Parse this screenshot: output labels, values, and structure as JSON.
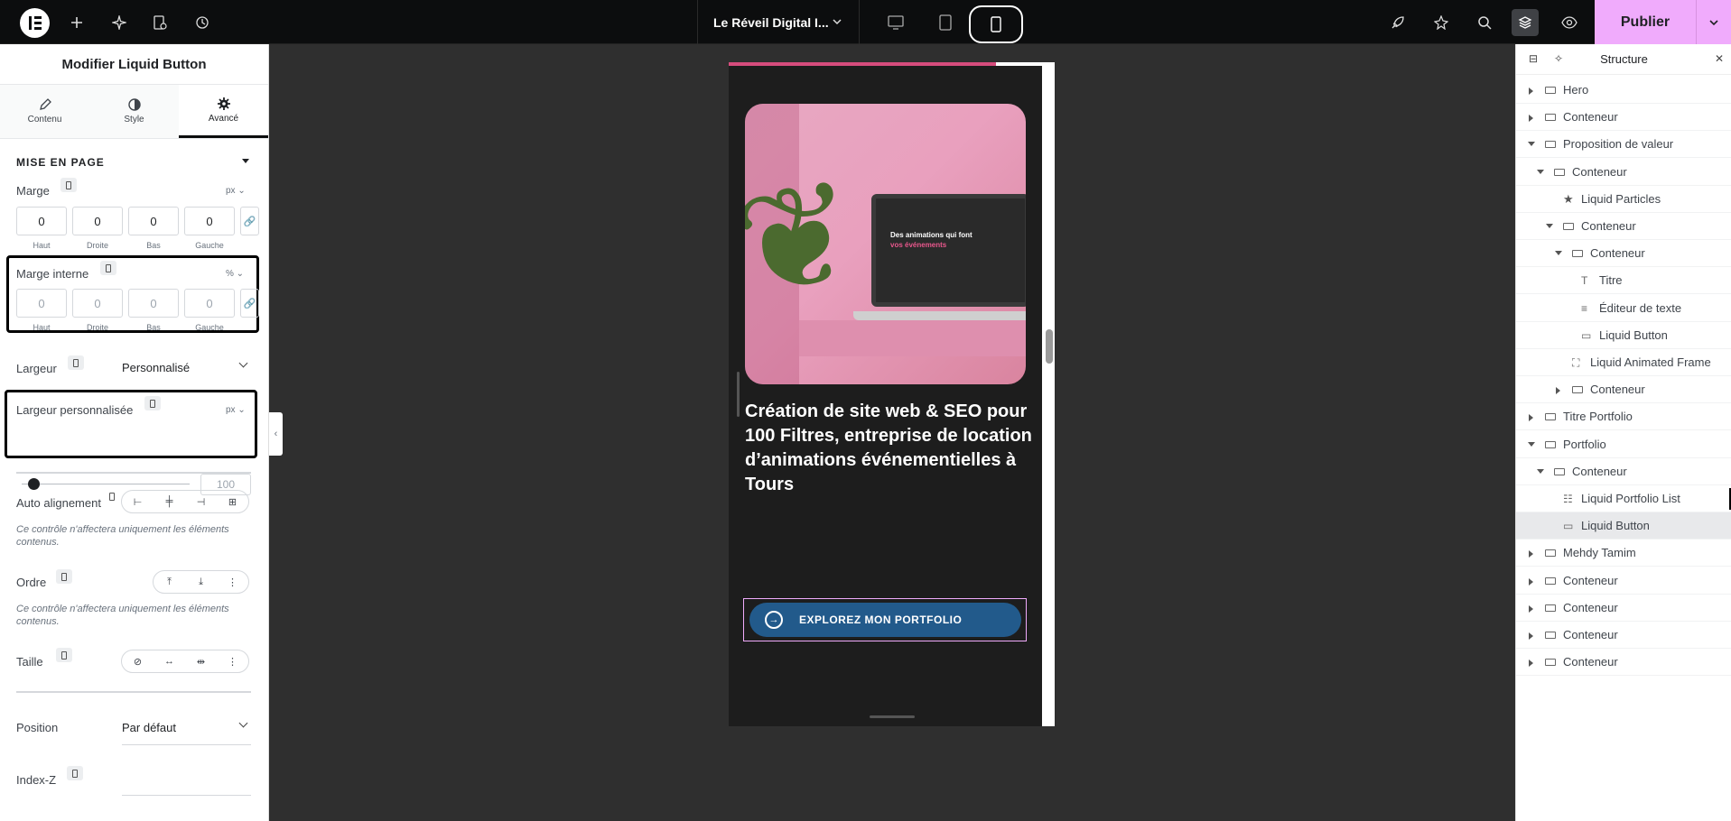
{
  "topbar": {
    "site_name": "Le Réveil Digital I...",
    "publish_label": "Publier",
    "left_icons": [
      "plus-icon",
      "sparkle-icon",
      "page-settings-icon",
      "history-icon"
    ],
    "right_icons": [
      "rocket-icon",
      "launch-icon",
      "search-icon",
      "layers-icon",
      "eye-icon"
    ],
    "devices": [
      "desktop",
      "tablet",
      "mobile"
    ],
    "active_device": "mobile",
    "accent": "#f0abfc"
  },
  "left_panel": {
    "title": "Modifier Liquid Button",
    "tabs": [
      {
        "label": "Contenu",
        "icon": "pencil-icon"
      },
      {
        "label": "Style",
        "icon": "contrast-icon"
      },
      {
        "label": "Avancé",
        "icon": "gear-icon"
      }
    ],
    "active_tab": "Avancé",
    "section": "MISE EN PAGE",
    "marge": {
      "label": "Marge",
      "unit": "px",
      "values": [
        "0",
        "0",
        "0",
        "0"
      ],
      "captions": [
        "Haut",
        "Droite",
        "Bas",
        "Gauche"
      ]
    },
    "marge_interne": {
      "label": "Marge interne",
      "unit": "%",
      "placeholders": [
        "0",
        "0",
        "0",
        "0"
      ],
      "captions": [
        "Haut",
        "Droite",
        "Bas",
        "Gauche"
      ]
    },
    "largeur": {
      "label": "Largeur",
      "value": "Personnalisé"
    },
    "largeur_perso": {
      "label": "Largeur personnalisée",
      "unit": "px",
      "value": "100",
      "slider_fraction": 0.05
    },
    "auto_alignement": {
      "label": "Auto alignement",
      "note": "Ce contrôle n'affectera uniquement les éléments contenus."
    },
    "ordre": {
      "label": "Ordre",
      "note": "Ce contrôle n'affectera uniquement les éléments contenus."
    },
    "taille": {
      "label": "Taille"
    },
    "position": {
      "label": "Position",
      "value": "Par défaut"
    },
    "index_z": {
      "label": "Index-Z"
    }
  },
  "preview": {
    "heading": "Création de site web & SEO pour 100 Filtres, entreprise de location d’animations événementielles à Tours",
    "button_label": "EXPLOREZ MON PORTFOLIO",
    "laptop_text_1": "Des animations qui font",
    "laptop_text_2": "vos événements",
    "colors": {
      "button": "#225a8b",
      "bar": "#d64c7d",
      "background": "#1d1d1d"
    }
  },
  "structure": {
    "title": "Structure",
    "items": [
      {
        "label": "Hero",
        "depth": 0,
        "caret": "right",
        "icon": "container"
      },
      {
        "label": "Conteneur",
        "depth": 0,
        "caret": "right",
        "icon": "container"
      },
      {
        "label": "Proposition de valeur",
        "depth": 0,
        "caret": "down",
        "icon": "container"
      },
      {
        "label": "Conteneur",
        "depth": 1,
        "caret": "down",
        "icon": "container"
      },
      {
        "label": "Liquid Particles",
        "depth": 2,
        "caret": "",
        "icon": "star"
      },
      {
        "label": "Conteneur",
        "depth": 2,
        "caret": "down",
        "icon": "container"
      },
      {
        "label": "Conteneur",
        "depth": 3,
        "caret": "down",
        "icon": "container"
      },
      {
        "label": "Titre",
        "depth": 4,
        "caret": "",
        "icon": "title"
      },
      {
        "label": "Éditeur de texte",
        "depth": 4,
        "caret": "",
        "icon": "text"
      },
      {
        "label": "Liquid Button",
        "depth": 4,
        "caret": "",
        "icon": "button"
      },
      {
        "label": "Liquid Animated Frame",
        "depth": 3,
        "caret": "",
        "icon": "frame"
      },
      {
        "label": "Conteneur",
        "depth": 3,
        "caret": "right",
        "icon": "container"
      },
      {
        "label": "Titre Portfolio",
        "depth": 0,
        "caret": "right",
        "icon": "container"
      },
      {
        "label": "Portfolio",
        "depth": 0,
        "caret": "down",
        "icon": "container"
      },
      {
        "label": "Conteneur",
        "depth": 1,
        "caret": "down",
        "icon": "container"
      },
      {
        "label": "Liquid Portfolio List",
        "depth": 2,
        "caret": "",
        "icon": "list"
      },
      {
        "label": "Liquid Button",
        "depth": 2,
        "caret": "",
        "icon": "button",
        "selected": true
      },
      {
        "label": "Mehdy Tamim",
        "depth": 0,
        "caret": "right",
        "icon": "container"
      },
      {
        "label": "Conteneur",
        "depth": 0,
        "caret": "right",
        "icon": "container"
      },
      {
        "label": "Conteneur",
        "depth": 0,
        "caret": "right",
        "icon": "container"
      },
      {
        "label": "Conteneur",
        "depth": 0,
        "caret": "right",
        "icon": "container"
      },
      {
        "label": "Conteneur",
        "depth": 0,
        "caret": "right",
        "icon": "container"
      }
    ]
  }
}
